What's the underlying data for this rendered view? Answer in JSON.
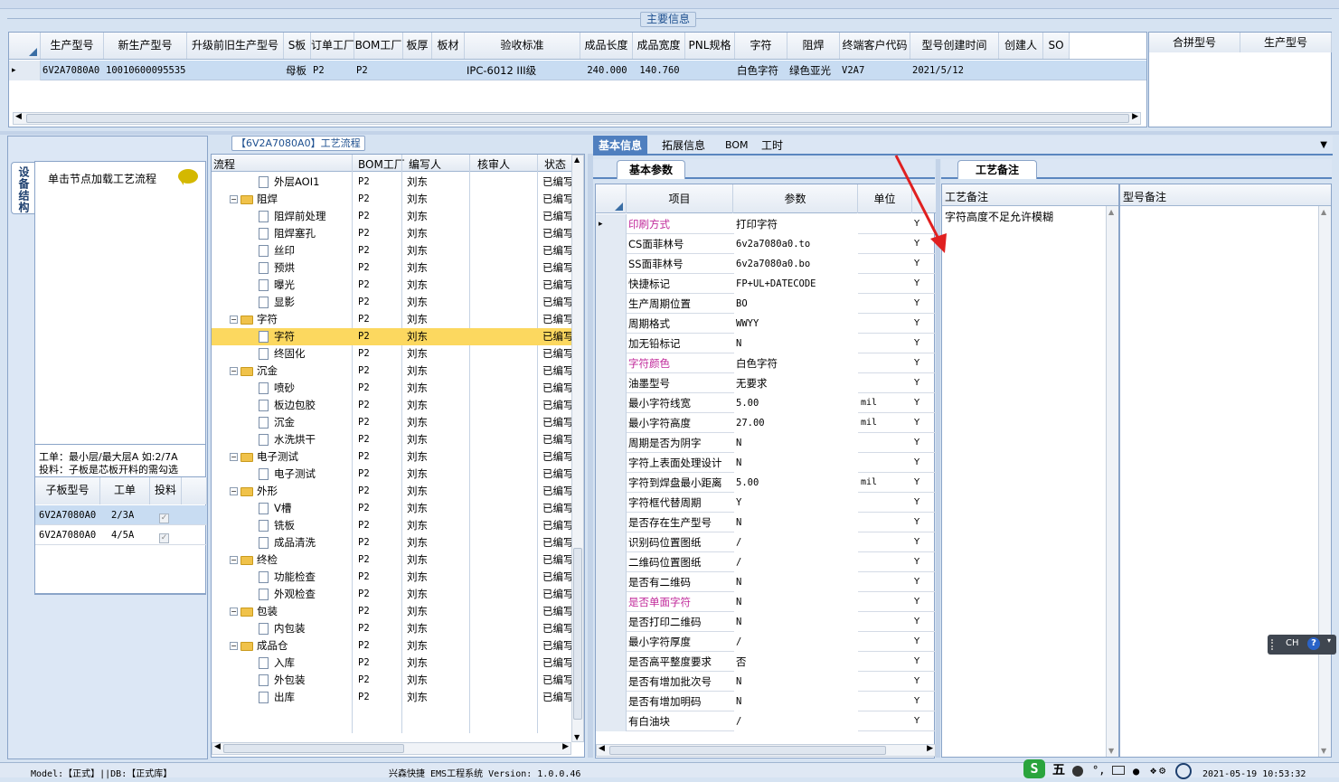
{
  "main_info": {
    "title": "主要信息",
    "columns": [
      "生产型号",
      "新生产型号",
      "升级前旧生产型号",
      "S板",
      "订单工厂",
      "BOM工厂",
      "板厚",
      "板材",
      "验收标准",
      "成品长度",
      "成品宽度",
      "PNL规格",
      "字符",
      "阻焊",
      "终端客户代码",
      "型号创建时间",
      "创建人",
      "SO"
    ],
    "row": {
      "生产型号": "6V2A7080A0",
      "新生产型号": "10010600095535",
      "S板": "母板",
      "订单工厂": "P2",
      "BOM工厂": "P2",
      "验收标准": "IPC-6012 III级",
      "成品长度": "240.000",
      "成品宽度": "140.760",
      "字符": "白色字符",
      "阻焊": "绿色亚光",
      "终端客户代码": "V2A7",
      "型号创建时间": "2021/5/12"
    },
    "side_columns": [
      "合拼型号",
      "生产型号"
    ]
  },
  "left_panel": {
    "vertical_tab": "设备结构",
    "hint": "单击节点加载工艺流程",
    "note_line1": "工单：最小层/最大层A 如:2/7A",
    "note_line2": "投料：子板是芯板开料的需勾选",
    "sub_columns": [
      "子板型号",
      "工单",
      "投料"
    ],
    "sub_rows": [
      {
        "model": "6V2A7080A0",
        "order": "2/3A"
      },
      {
        "model": "6V2A7080A0",
        "order": "4/5A"
      }
    ]
  },
  "flow": {
    "title": "【6V2A7080A0】工艺流程",
    "columns": [
      "流程",
      "BOM工厂",
      "编写人",
      "核审人",
      "状态"
    ],
    "rows": [
      {
        "name": "外层AOI1",
        "kind": "doc",
        "bom": "P2",
        "writer": "刘东",
        "status": "已编写"
      },
      {
        "name": "阻焊",
        "kind": "folder",
        "bom": "P2",
        "writer": "刘东",
        "status": "已编写"
      },
      {
        "name": "阻焊前处理",
        "kind": "doc",
        "bom": "P2",
        "writer": "刘东",
        "status": "已编写"
      },
      {
        "name": "阻焊塞孔",
        "kind": "doc",
        "bom": "P2",
        "writer": "刘东",
        "status": "已编写"
      },
      {
        "name": "丝印",
        "kind": "doc",
        "bom": "P2",
        "writer": "刘东",
        "status": "已编写"
      },
      {
        "name": "预烘",
        "kind": "doc",
        "bom": "P2",
        "writer": "刘东",
        "status": "已编写"
      },
      {
        "name": "曝光",
        "kind": "doc",
        "bom": "P2",
        "writer": "刘东",
        "status": "已编写"
      },
      {
        "name": "显影",
        "kind": "doc",
        "bom": "P2",
        "writer": "刘东",
        "status": "已编写"
      },
      {
        "name": "字符",
        "kind": "folder",
        "bom": "P2",
        "writer": "刘东",
        "status": "已编写"
      },
      {
        "name": "字符",
        "kind": "doc",
        "bom": "P2",
        "writer": "刘东",
        "status": "已编写",
        "selected": true
      },
      {
        "name": "终固化",
        "kind": "doc",
        "bom": "P2",
        "writer": "刘东",
        "status": "已编写"
      },
      {
        "name": "沉金",
        "kind": "folder",
        "bom": "P2",
        "writer": "刘东",
        "status": "已编写"
      },
      {
        "name": "喷砂",
        "kind": "doc",
        "bom": "P2",
        "writer": "刘东",
        "status": "已编写"
      },
      {
        "name": "板边包胶",
        "kind": "doc",
        "bom": "P2",
        "writer": "刘东",
        "status": "已编写"
      },
      {
        "name": "沉金",
        "kind": "doc",
        "bom": "P2",
        "writer": "刘东",
        "status": "已编写"
      },
      {
        "name": "水洗烘干",
        "kind": "doc",
        "bom": "P2",
        "writer": "刘东",
        "status": "已编写"
      },
      {
        "name": "电子测试",
        "kind": "folder",
        "bom": "P2",
        "writer": "刘东",
        "status": "已编写"
      },
      {
        "name": "电子测试",
        "kind": "doc",
        "bom": "P2",
        "writer": "刘东",
        "status": "已编写"
      },
      {
        "name": "外形",
        "kind": "folder",
        "bom": "P2",
        "writer": "刘东",
        "status": "已编写"
      },
      {
        "name": "V槽",
        "kind": "doc",
        "bom": "P2",
        "writer": "刘东",
        "status": "已编写"
      },
      {
        "name": "铣板",
        "kind": "doc",
        "bom": "P2",
        "writer": "刘东",
        "status": "已编写"
      },
      {
        "name": "成品清洗",
        "kind": "doc",
        "bom": "P2",
        "writer": "刘东",
        "status": "已编写"
      },
      {
        "name": "终检",
        "kind": "folder",
        "bom": "P2",
        "writer": "刘东",
        "status": "已编写"
      },
      {
        "name": "功能检查",
        "kind": "doc",
        "bom": "P2",
        "writer": "刘东",
        "status": "已编写"
      },
      {
        "name": "外观检查",
        "kind": "doc",
        "bom": "P2",
        "writer": "刘东",
        "status": "已编写"
      },
      {
        "name": "包装",
        "kind": "folder",
        "bom": "P2",
        "writer": "刘东",
        "status": "已编写"
      },
      {
        "name": "内包装",
        "kind": "doc",
        "bom": "P2",
        "writer": "刘东",
        "status": "已编写"
      },
      {
        "name": "成品仓",
        "kind": "folder",
        "bom": "P2",
        "writer": "刘东",
        "status": "已编写"
      },
      {
        "name": "入库",
        "kind": "doc",
        "bom": "P2",
        "writer": "刘东",
        "status": "已编写"
      },
      {
        "name": "外包装",
        "kind": "doc",
        "bom": "P2",
        "writer": "刘东",
        "status": "已编写"
      },
      {
        "name": "出库",
        "kind": "doc",
        "bom": "P2",
        "writer": "刘东",
        "status": "已编写"
      }
    ]
  },
  "right_tabs": [
    "基本信息",
    "拓展信息",
    "BOM",
    "工时"
  ],
  "params": {
    "subtab": "基本参数",
    "columns": [
      "项目",
      "参数",
      "单位"
    ],
    "rows": [
      {
        "item": "印刷方式",
        "value": "打印字符",
        "unit": "",
        "flag": "Y",
        "hl": true
      },
      {
        "item": "CS面菲林号",
        "value": "6v2a7080a0.to",
        "unit": "",
        "flag": "Y"
      },
      {
        "item": "SS面菲林号",
        "value": "6v2a7080a0.bo",
        "unit": "",
        "flag": "Y"
      },
      {
        "item": "快捷标记",
        "value": "FP+UL+DATECODE",
        "unit": "",
        "flag": "Y"
      },
      {
        "item": "生产周期位置",
        "value": "BO",
        "unit": "",
        "flag": "Y"
      },
      {
        "item": "周期格式",
        "value": "WWYY",
        "unit": "",
        "flag": "Y"
      },
      {
        "item": "加无铅标记",
        "value": "N",
        "unit": "",
        "flag": "Y"
      },
      {
        "item": "字符颜色",
        "value": "白色字符",
        "unit": "",
        "flag": "Y",
        "hl": true
      },
      {
        "item": "油墨型号",
        "value": "无要求",
        "unit": "",
        "flag": "Y"
      },
      {
        "item": "最小字符线宽",
        "value": "5.00",
        "unit": "mil",
        "flag": "Y"
      },
      {
        "item": "最小字符高度",
        "value": "27.00",
        "unit": "mil",
        "flag": "Y"
      },
      {
        "item": "周期是否为阴字",
        "value": "N",
        "unit": "",
        "flag": "Y"
      },
      {
        "item": "字符上表面处理设计",
        "value": "N",
        "unit": "",
        "flag": "Y"
      },
      {
        "item": "字符到焊盘最小距离",
        "value": "5.00",
        "unit": "mil",
        "flag": "Y"
      },
      {
        "item": "字符框代替周期",
        "value": "Y",
        "unit": "",
        "flag": "Y"
      },
      {
        "item": "是否存在生产型号",
        "value": "N",
        "unit": "",
        "flag": "Y"
      },
      {
        "item": "识别码位置图纸",
        "value": "/",
        "unit": "",
        "flag": "Y"
      },
      {
        "item": "二维码位置图纸",
        "value": "/",
        "unit": "",
        "flag": "Y"
      },
      {
        "item": "是否有二维码",
        "value": "N",
        "unit": "",
        "flag": "Y"
      },
      {
        "item": "是否单面字符",
        "value": "N",
        "unit": "",
        "flag": "Y",
        "hl": true
      },
      {
        "item": "是否打印二维码",
        "value": "N",
        "unit": "",
        "flag": "Y"
      },
      {
        "item": "最小字符厚度",
        "value": "/",
        "unit": "",
        "flag": "Y"
      },
      {
        "item": "是否高平整度要求",
        "value": "否",
        "unit": "",
        "flag": "Y"
      },
      {
        "item": "是否有增加批次号",
        "value": "N",
        "unit": "",
        "flag": "Y"
      },
      {
        "item": "是否有增加明码",
        "value": "N",
        "unit": "",
        "flag": "Y"
      },
      {
        "item": "有白油块",
        "value": "/",
        "unit": "",
        "flag": "Y"
      }
    ]
  },
  "notes": {
    "tab": "工艺备注",
    "col1": "工艺备注",
    "col2": "型号备注",
    "text": "字符高度不足允许模糊"
  },
  "status": {
    "left": "Model:【正式】||DB:【正式库】",
    "center": "兴森快捷 EMS工程系统 Version: 1.0.0.46",
    "ime": "五",
    "datetime": "2021-05-19 10:53:32",
    "lang": "CH"
  },
  "colors": {
    "accent": "#2e6bb5",
    "selected_row": "#c8dcf2",
    "tree_selected": "#fcd85f",
    "highlight_text": "#c0289a",
    "arrow": "#e02020"
  }
}
